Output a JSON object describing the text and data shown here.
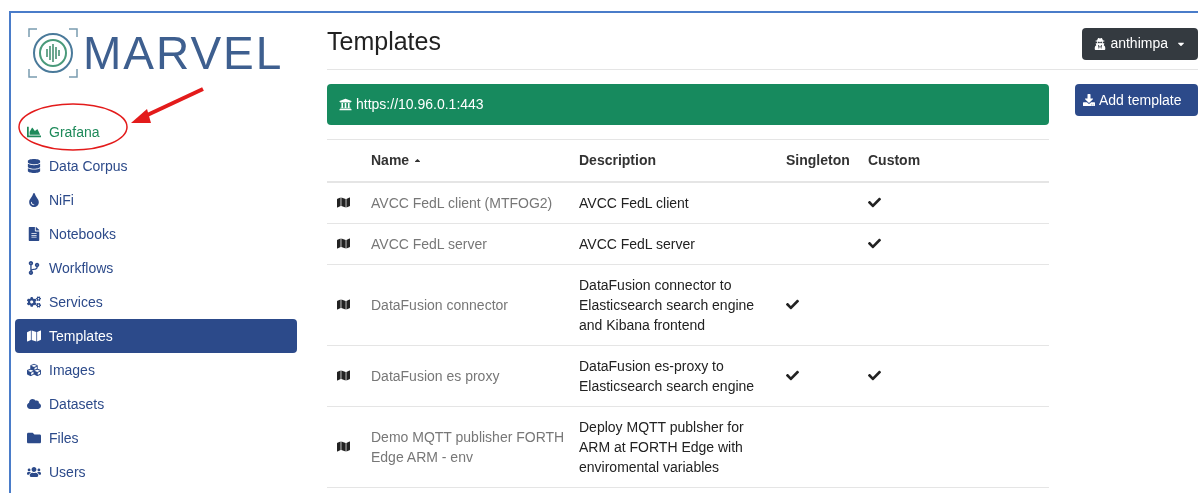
{
  "logo": {
    "text": "MARVEL"
  },
  "sidebar": {
    "items": [
      {
        "label": "Grafana",
        "selected": false,
        "color": "#1e8a5a",
        "circled": true
      },
      {
        "label": "Data Corpus",
        "selected": false,
        "color": "#2c4a8a",
        "circled": false
      },
      {
        "label": "NiFi",
        "selected": false,
        "color": "#2c4a8a",
        "circled": false
      },
      {
        "label": "Notebooks",
        "selected": false,
        "color": "#2c4a8a",
        "circled": false
      },
      {
        "label": "Workflows",
        "selected": false,
        "color": "#2c4a8a",
        "circled": false
      },
      {
        "label": "Services",
        "selected": false,
        "color": "#2c4a8a",
        "circled": false
      },
      {
        "label": "Templates",
        "selected": true,
        "color": "#2c4a8a",
        "circled": false
      },
      {
        "label": "Images",
        "selected": false,
        "color": "#2c4a8a",
        "circled": false
      },
      {
        "label": "Datasets",
        "selected": false,
        "color": "#2c4a8a",
        "circled": false
      },
      {
        "label": "Files",
        "selected": false,
        "color": "#2c4a8a",
        "circled": false
      },
      {
        "label": "Users",
        "selected": false,
        "color": "#2c4a8a",
        "circled": false
      }
    ]
  },
  "page_title": "Templates",
  "user_menu": {
    "label": "anthimpa"
  },
  "server_banner": {
    "url": "https://10.96.0.1:443"
  },
  "add_button": {
    "label": "Add template"
  },
  "table": {
    "columns": [
      {
        "label": "Name",
        "sorted": true
      },
      {
        "label": "Description",
        "sorted": false
      },
      {
        "label": "Singleton",
        "sorted": false
      },
      {
        "label": "Custom",
        "sorted": false
      }
    ],
    "rows": [
      {
        "name": "AVCC FedL client (MTFOG2)",
        "description": "AVCC FedL client",
        "singleton": false,
        "custom": true
      },
      {
        "name": "AVCC FedL server",
        "description": "AVCC FedL server",
        "singleton": false,
        "custom": true
      },
      {
        "name": "DataFusion connector",
        "description": "DataFusion connector to Elasticsearch search engine and Kibana frontend",
        "singleton": true,
        "custom": false
      },
      {
        "name": "DataFusion es proxy",
        "description": "DataFusion es-proxy to Elasticsearch search engine",
        "singleton": true,
        "custom": true
      },
      {
        "name": "Demo MQTT publisher FORTH Edge ARM - env",
        "description": "Deploy MQTT publsher for ARM at FORTH Edge with enviromental variables",
        "singleton": false,
        "custom": false
      }
    ]
  }
}
